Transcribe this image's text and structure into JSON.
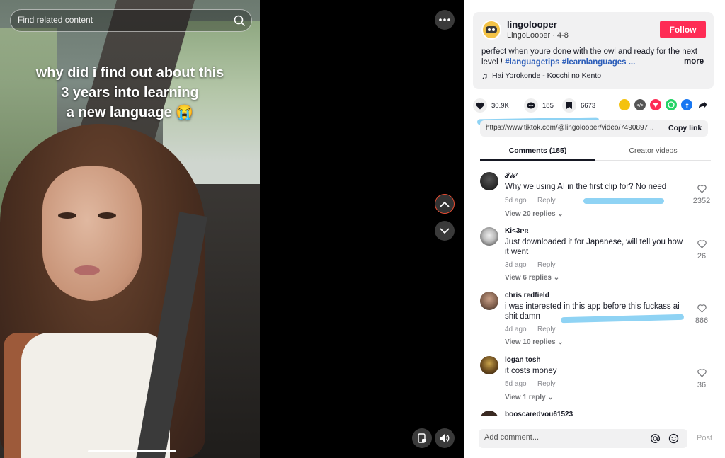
{
  "search": {
    "placeholder": "Find related content"
  },
  "video": {
    "caption_lines": [
      "why did i find out about this",
      "3 years into learning",
      "a new language 😭"
    ]
  },
  "author": {
    "name": "lingolooper",
    "subtitle": "LingoLooper · 4-8",
    "follow_label": "Follow",
    "description_text": "perfect when youre done with the owl and ready for the next level ! ",
    "hashtags": "#languagetips #learnlanguages ...",
    "more_label": "more",
    "music": "Hai Yorokonde - Kocchi no Kento"
  },
  "stats": {
    "likes": "30.9K",
    "comments": "185",
    "saves": "6673"
  },
  "share_colors": {
    "gold": "#f4c20d",
    "embed": "#555555",
    "red": "#fe2c55",
    "whatsapp": "#25d366",
    "facebook": "#1877f2"
  },
  "link": {
    "url": "https://www.tiktok.com/@lingolooper/video/7490897...",
    "copy_label": "Copy link"
  },
  "tabs": {
    "comments": "Comments (185)",
    "creator": "Creator videos"
  },
  "comments": [
    {
      "user": "𝒯𝒾𝓈⁷",
      "text": "Why we using AI in the first clip for? No need",
      "time": "5d ago",
      "reply": "Reply",
      "likes": "2352",
      "view": "View 20 replies ⌄"
    },
    {
      "user": "Ki<3ᴘʀ",
      "text": "Just downloaded it for Japanese, will tell you how it went",
      "time": "3d ago",
      "reply": "Reply",
      "likes": "26",
      "view": "View 6 replies ⌄"
    },
    {
      "user": "chris redfield",
      "text": "i was interested in this app before this fuckass ai shit damn",
      "time": "4d ago",
      "reply": "Reply",
      "likes": "866",
      "view": "View 10 replies ⌄"
    },
    {
      "user": "logan tosh",
      "text": "it costs money",
      "time": "5d ago",
      "reply": "Reply",
      "likes": "36",
      "view": "View 1 reply ⌄"
    },
    {
      "user": "booscaredyou61523",
      "text": "",
      "time": "",
      "reply": "",
      "likes": "",
      "view": ""
    }
  ],
  "footer": {
    "placeholder": "Add comment...",
    "post_label": "Post"
  }
}
